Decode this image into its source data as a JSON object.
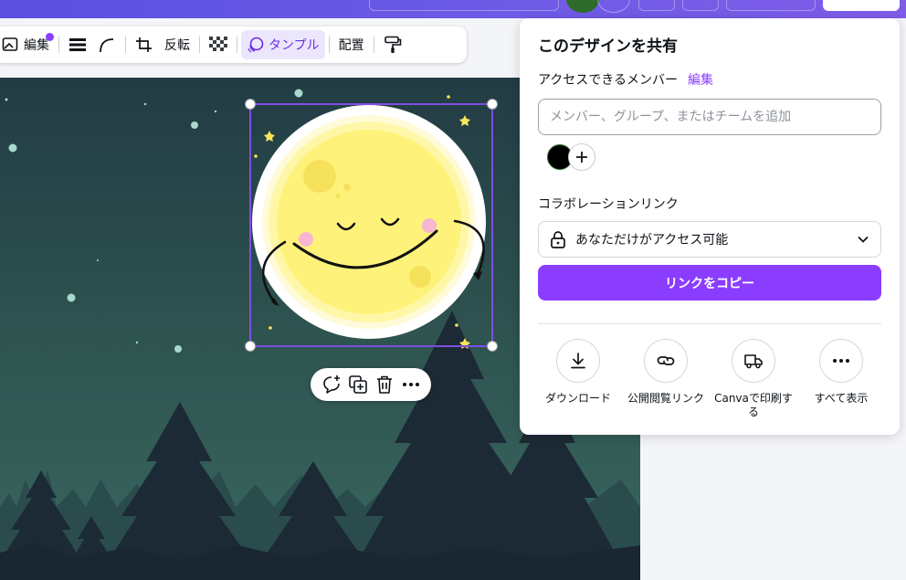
{
  "toolbar": {
    "edit_label": "編集",
    "flip_label": "反転",
    "tempo_label": "タンプル",
    "arrange_label": "配置"
  },
  "share_panel": {
    "title": "このデザインを共有",
    "members_label": "アクセスできるメンバー",
    "edit_link": "編集",
    "member_placeholder": "メンバー、グループ、またはチームを追加",
    "collab_label": "コラボレーションリンク",
    "access_value": "あなただけがアクセス可能",
    "copy_button": "リンクをコピー",
    "actions": [
      {
        "label": "ダウンロード",
        "icon": "download-icon"
      },
      {
        "label": "公開閲覧リンク",
        "icon": "link-icon"
      },
      {
        "label": "Canvaで印刷する",
        "icon": "truck-icon"
      },
      {
        "label": "すべて表示",
        "icon": "more-icon"
      }
    ]
  },
  "colors": {
    "accent": "#8b3dff",
    "topbar": "#6457e4",
    "sky": "#243f45",
    "tree_dark": "#1c2a36",
    "moon": "#fff27a"
  }
}
